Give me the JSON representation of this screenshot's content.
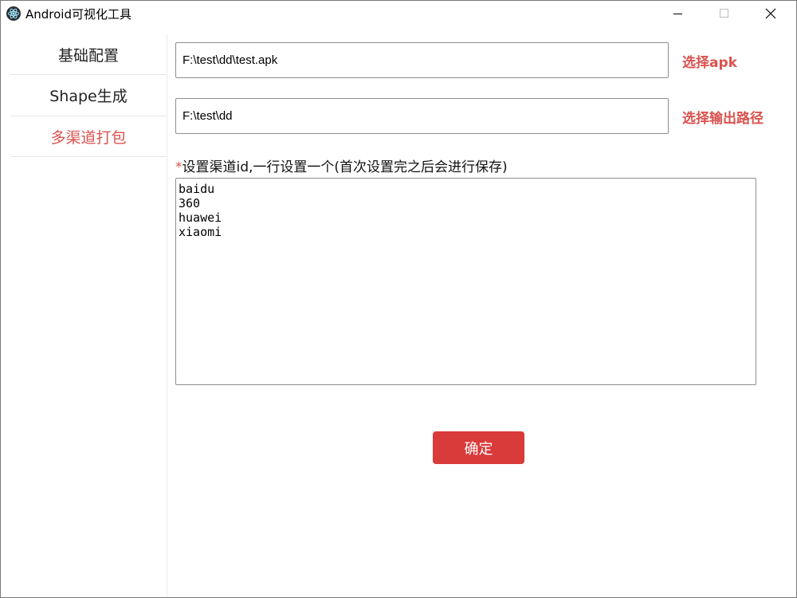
{
  "window": {
    "title": "Android可视化工具",
    "icon": "electron-app-icon"
  },
  "sidebar": {
    "items": [
      {
        "label": "基础配置",
        "active": false
      },
      {
        "label": "Shape生成",
        "active": false
      },
      {
        "label": "多渠道打包",
        "active": true
      }
    ]
  },
  "form": {
    "apk_path": "F:\\test\\dd\\test.apk",
    "select_apk_label": "选择apk",
    "output_path": "F:\\test\\dd",
    "select_output_label": "选择输出路径",
    "channel_required_mark": "*",
    "channel_label": "设置渠道id,一行设置一个(首次设置完之后会进行保存)",
    "channel_ids": "baidu\n360\nhuawei\nxiaomi",
    "confirm_label": "确定"
  },
  "colors": {
    "accent": "#d9534f",
    "button": "#d93a3a"
  }
}
